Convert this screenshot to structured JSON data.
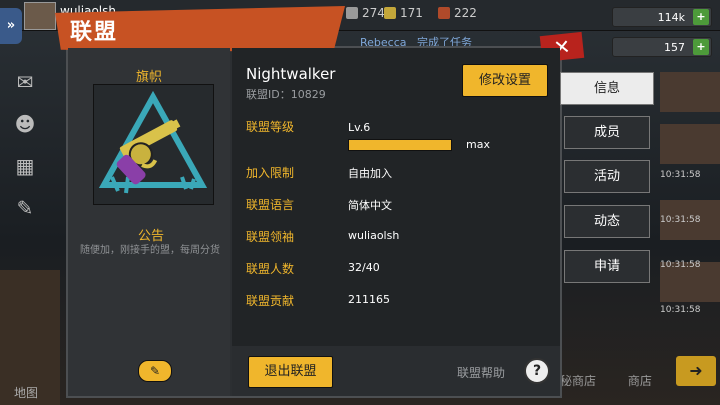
{
  "background": {
    "username": "wuliaolsh",
    "resources": [
      {
        "value": "274",
        "color": "#9a9a9a"
      },
      {
        "value": "171",
        "color": "#c4a73a"
      },
      {
        "value": "222",
        "color": "#b04a2a"
      }
    ],
    "right_resources": [
      {
        "value": "114k",
        "icon": "food-icon"
      },
      {
        "value": "157",
        "icon": "cash-icon"
      }
    ],
    "chat_name": "Rebecca",
    "chat_text": "完成了任务",
    "times": [
      "10:31:58",
      "10:31:58",
      "10:31:58",
      "10:31:58"
    ],
    "map_label": "地图",
    "bottom_labels": [
      "秘商店",
      "商店"
    ]
  },
  "modal": {
    "title": "联盟",
    "close_icon": "close-x-icon",
    "flag_label": "旗帜",
    "notice_label": "公告",
    "notice_text": "随便加，刚接手的盟，每周分货",
    "alliance_name": "Nightwalker",
    "alliance_id": "联盟ID：10829",
    "modify_button": "修改设置",
    "level_label": "联盟等级",
    "level_value": "Lv.6",
    "level_progress": 1.0,
    "level_max": "max",
    "rows": [
      {
        "label": "加入限制",
        "value": "自由加入"
      },
      {
        "label": "联盟语言",
        "value": "简体中文"
      },
      {
        "label": "联盟领袖",
        "value": "wuliaolsh"
      },
      {
        "label": "联盟人数",
        "value": "32/40"
      },
      {
        "label": "联盟贡献",
        "value": "211165"
      }
    ],
    "quit_button": "退出联盟",
    "help_text": "联盟帮助",
    "help_icon": "?",
    "tabs": [
      "信息",
      "成员",
      "活动",
      "动态",
      "申请"
    ],
    "active_tab": 0,
    "accent_color": "#f0b62c"
  }
}
